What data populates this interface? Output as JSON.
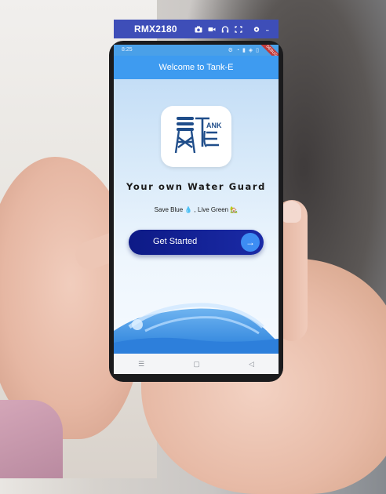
{
  "device": {
    "name": "RMX2180",
    "toolbar_icons": [
      "camera-icon",
      "video-icon",
      "headset-icon",
      "fullscreen-icon",
      "settings-icon",
      "minimize-icon"
    ]
  },
  "status_bar": {
    "time": "8:25",
    "icons_text": "⚙ ◔ ▮ ◈ ▯",
    "debug_label": "DEBUG"
  },
  "app": {
    "title": "Welcome to Tank-E",
    "logo_text": "TANK-E",
    "tagline": "Your own Water Guard",
    "slogan": "Save Blue 💧 , Live Green 🏡",
    "cta_label": "Get Started",
    "cta_icon": "arrow-right-icon",
    "colors": {
      "appbar": "#3e9bf0",
      "button": "#0d1a86",
      "button_circle": "#3d8df3"
    }
  },
  "navigation": {
    "recents": "☰",
    "home": "▢",
    "back": "◁"
  }
}
